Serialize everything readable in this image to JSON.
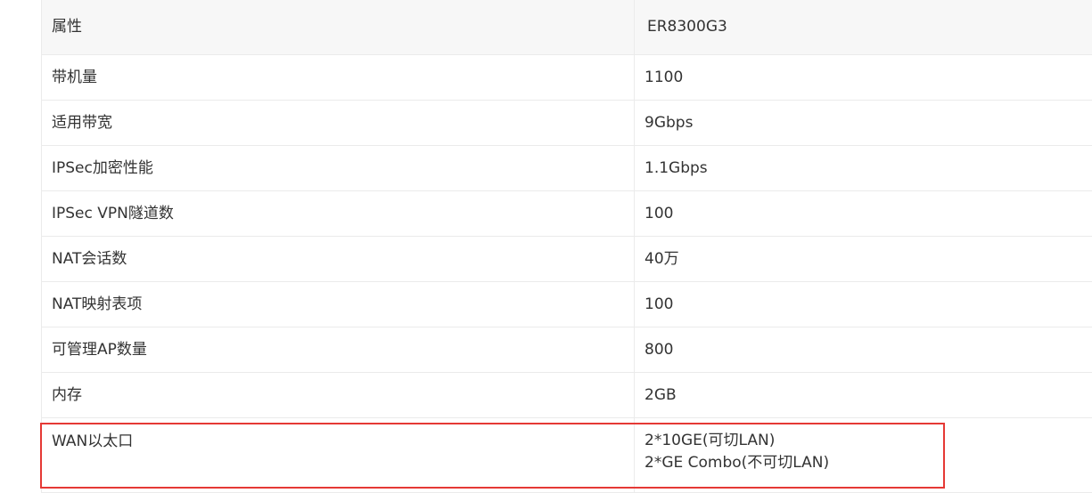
{
  "table": {
    "header": {
      "attribute": "属性",
      "value": "ER8300G3"
    },
    "rows": [
      {
        "label": "带机量",
        "values": [
          "1100"
        ]
      },
      {
        "label": "适用带宽",
        "values": [
          "9Gbps"
        ]
      },
      {
        "label": "IPSec加密性能",
        "values": [
          "1.1Gbps"
        ]
      },
      {
        "label": "IPSec VPN隧道数",
        "values": [
          "100"
        ]
      },
      {
        "label": "NAT会话数",
        "values": [
          "40万"
        ]
      },
      {
        "label": "NAT映射表项",
        "values": [
          "100"
        ]
      },
      {
        "label": "可管理AP数量",
        "values": [
          "800"
        ]
      },
      {
        "label": "内存",
        "values": [
          "2GB"
        ]
      },
      {
        "label": "WAN以太口",
        "values": [
          "2*10GE(可切LAN)",
          "2*GE Combo(不可切LAN)"
        ]
      }
    ]
  },
  "highlight": {
    "color": "#e53935",
    "target_row": "WAN以太口"
  },
  "colors": {
    "header_background": "#f7f7f7",
    "border": "#ebebeb",
    "text": "#333333"
  }
}
